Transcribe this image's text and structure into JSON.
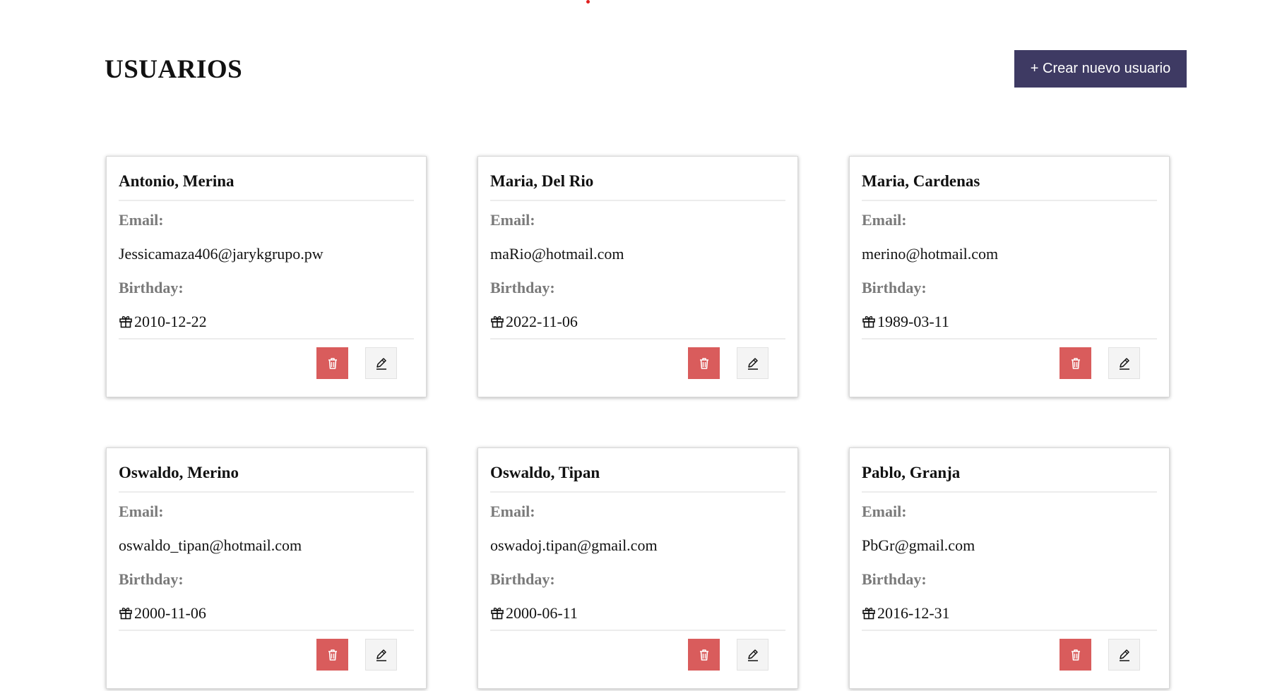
{
  "header": {
    "title": "USUARIOS",
    "create_button_label": "+ Crear nuevo usuario"
  },
  "labels": {
    "email": "Email:",
    "birthday": "Birthday:"
  },
  "colors": {
    "primary_button": "#3e3a63",
    "delete_button": "#d95c5c",
    "edit_button": "#f4f4f4",
    "label_text": "#7a7a7a"
  },
  "icons": {
    "birthday": "gift-icon",
    "delete": "trash-icon",
    "edit": "pencil-icon"
  },
  "users": [
    {
      "name": "Antonio, Merina",
      "email": "Jessicamaza406@jarykgrupo.pw",
      "birthday": "2010-12-22"
    },
    {
      "name": "Maria, Del Rio",
      "email": "maRio@hotmail.com",
      "birthday": "2022-11-06"
    },
    {
      "name": "Maria, Cardenas",
      "email": "merino@hotmail.com",
      "birthday": "1989-03-11"
    },
    {
      "name": "Oswaldo, Merino",
      "email": "oswaldo_tipan@hotmail.com",
      "birthday": "2000-11-06"
    },
    {
      "name": "Oswaldo, Tipan",
      "email": "oswadoj.tipan@gmail.com",
      "birthday": "2000-06-11"
    },
    {
      "name": "Pablo, Granja",
      "email": "PbGr@gmail.com",
      "birthday": "2016-12-31"
    }
  ]
}
